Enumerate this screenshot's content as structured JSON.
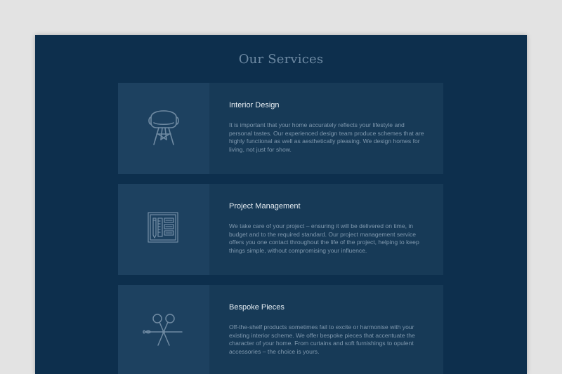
{
  "services": {
    "title": "Our Services",
    "items": [
      {
        "title": "Interior Design",
        "icon": "chair-icon",
        "text": "It is important that your home accurately reflects your lifestyle and personal tastes. Our experienced design team produce schemes that are highly functional as well as aesthetically pleasing. We design homes for living, not just for show."
      },
      {
        "title": "Project Management",
        "icon": "blueprint-icon",
        "text": "We take care of your project – ensuring it will be delivered on time, in budget and to the required standard. Our project management service offers you one contact throughout the life of the project, helping to keep things simple, without compromising your influence."
      },
      {
        "title": "Bespoke Pieces",
        "icon": "scissors-needle-icon",
        "text": "Off-the-shelf products sometimes fail to excite or harmonise with your existing interior scheme. We offer bespoke pieces that accentuate the character of your home. From curtains and soft furnishings to opulent accessories – the choice is yours."
      }
    ]
  },
  "colors": {
    "background": "#e3e3e3",
    "page": "#0d2f4d",
    "card": "#173a57",
    "icon_panel": "#1d4160",
    "icon_stroke": "#6f8aa2"
  }
}
